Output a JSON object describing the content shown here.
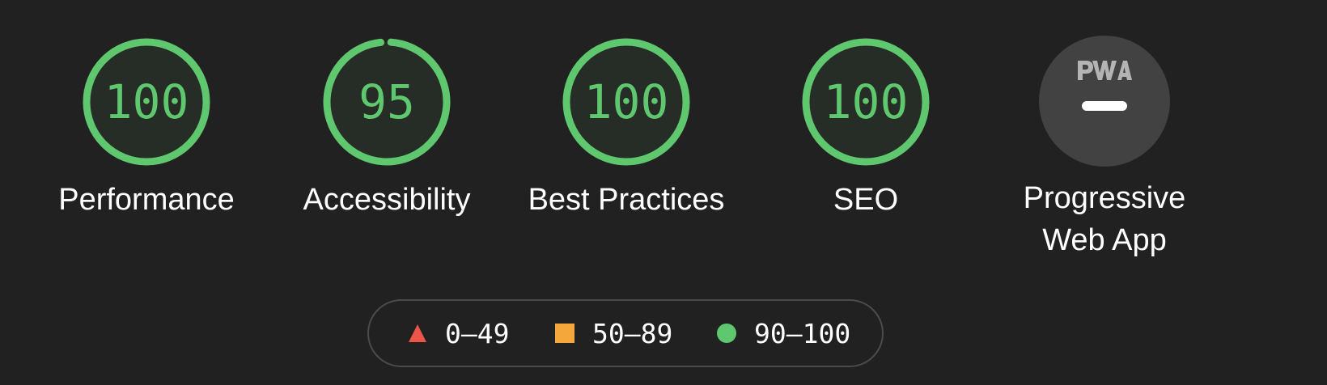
{
  "colors": {
    "pass": "#5fc86f",
    "average": "#f4a73b",
    "fail": "#ec5548",
    "background": "#212121",
    "ring_fill": "#262c26",
    "pwa_background": "#424242"
  },
  "gauges": [
    {
      "score": "100",
      "label": "Performance",
      "fraction": 1.0
    },
    {
      "score": "95",
      "label": "Accessibility",
      "fraction": 0.95
    },
    {
      "score": "100",
      "label": "Best Practices",
      "fraction": 1.0
    },
    {
      "score": "100",
      "label": "SEO",
      "fraction": 1.0
    }
  ],
  "pwa": {
    "label_line1": "Progressive",
    "label_line2": "Web App",
    "logo_icon": "pwa-logo-icon",
    "status_icon": "dash-icon"
  },
  "legend": [
    {
      "icon": "triangle-icon",
      "range": "0–49"
    },
    {
      "icon": "square-icon",
      "range": "50–89"
    },
    {
      "icon": "circle-icon",
      "range": "90–100"
    }
  ]
}
